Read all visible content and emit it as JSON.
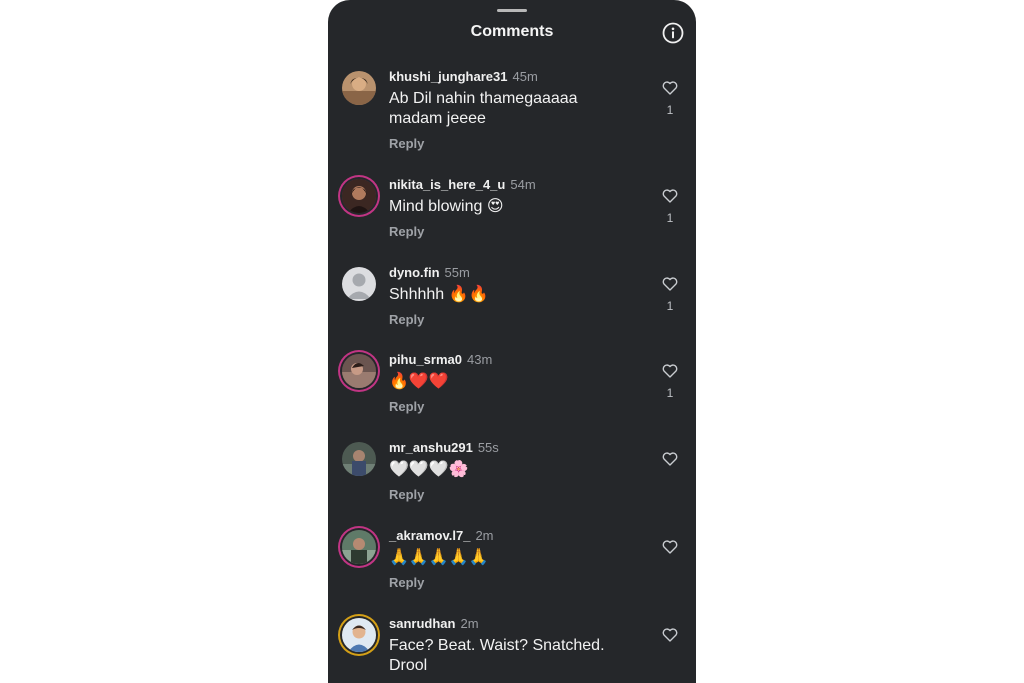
{
  "header": {
    "title": "Comments"
  },
  "comments": [
    {
      "username": "khushi_junghare31",
      "time": "45m",
      "text": "Ab Dil nahin thamegaaaaa madam jeeee",
      "reply": "Reply",
      "likes": "1"
    },
    {
      "username": "nikita_is_here_4_u",
      "time": "54m",
      "text": "Mind blowing 😍",
      "reply": "Reply",
      "likes": "1"
    },
    {
      "username": "dyno.fin",
      "time": "55m",
      "text": "Shhhhh 🔥🔥",
      "reply": "Reply",
      "likes": "1"
    },
    {
      "username": "pihu_srma0",
      "time": "43m",
      "text": "🔥❤️❤️",
      "reply": "Reply",
      "likes": "1"
    },
    {
      "username": "mr_anshu291",
      "time": "55s",
      "text": "🤍🤍🤍🌸",
      "reply": "Reply",
      "likes": ""
    },
    {
      "username": "_akramov.l7_",
      "time": "2m",
      "text": "🙏🙏🙏🙏🙏",
      "reply": "Reply",
      "likes": ""
    },
    {
      "username": "sanrudhan",
      "time": "2m",
      "text": "Face? Beat. Waist? Snatched. Drool",
      "reply": "",
      "likes": ""
    }
  ],
  "colors": {
    "panel_bg": "#25272a",
    "story_ring": "#c13584",
    "muted_text": "#9fa2a7"
  },
  "icons": {
    "info": "info-icon",
    "like": "heart-outline-icon"
  }
}
